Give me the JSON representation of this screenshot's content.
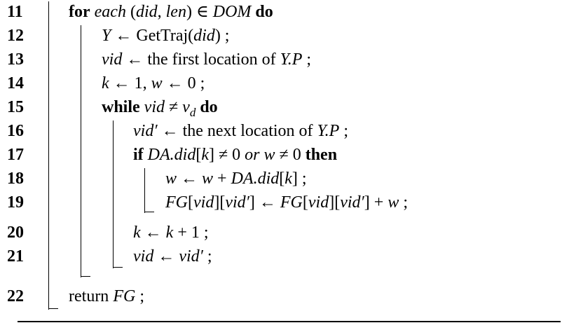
{
  "lines": [
    {
      "num": "11",
      "parts": [
        {
          "t": "for",
          "s": "kw"
        },
        {
          "t": " each",
          "s": "m"
        },
        {
          "t": " (",
          "s": ""
        },
        {
          "t": "did",
          "s": "m"
        },
        {
          "t": ", ",
          "s": ""
        },
        {
          "t": "len",
          "s": "m"
        },
        {
          "t": ") ∈ ",
          "s": ""
        },
        {
          "t": "DOM",
          "s": "m"
        },
        {
          "t": " do",
          "s": "kw"
        }
      ]
    },
    {
      "num": "12",
      "parts": [
        {
          "t": "Y",
          "s": "m"
        },
        {
          "t": " ← GetTraj(",
          "s": ""
        },
        {
          "t": "did",
          "s": "m"
        },
        {
          "t": ") ;",
          "s": ""
        }
      ]
    },
    {
      "num": "13",
      "parts": [
        {
          "t": "vid",
          "s": "m"
        },
        {
          "t": " ← the first location of ",
          "s": ""
        },
        {
          "t": "Y.P",
          "s": "m"
        },
        {
          "t": " ;",
          "s": ""
        }
      ]
    },
    {
      "num": "14",
      "parts": [
        {
          "t": "k",
          "s": "m"
        },
        {
          "t": " ← 1, ",
          "s": ""
        },
        {
          "t": "w",
          "s": "m"
        },
        {
          "t": " ← 0 ;",
          "s": ""
        }
      ]
    },
    {
      "num": "15",
      "parts": [
        {
          "t": "while",
          "s": "kw"
        },
        {
          "t": " vid",
          "s": "m"
        },
        {
          "t": " ≠ ",
          "s": ""
        },
        {
          "t": "v",
          "s": "m"
        },
        {
          "t": "d",
          "s": "sub"
        },
        {
          "t": " do",
          "s": "kw"
        }
      ]
    },
    {
      "num": "16",
      "parts": [
        {
          "t": "vid′",
          "s": "m"
        },
        {
          "t": " ← the next location of ",
          "s": ""
        },
        {
          "t": "Y.P",
          "s": "m"
        },
        {
          "t": " ;",
          "s": ""
        }
      ]
    },
    {
      "num": "17",
      "parts": [
        {
          "t": "if",
          "s": "kw"
        },
        {
          "t": " DA.did",
          "s": "m"
        },
        {
          "t": "[",
          "s": ""
        },
        {
          "t": "k",
          "s": "m"
        },
        {
          "t": "] ≠ 0 ",
          "s": ""
        },
        {
          "t": "or",
          "s": "m"
        },
        {
          "t": " ",
          "s": ""
        },
        {
          "t": "w",
          "s": "m"
        },
        {
          "t": " ≠ 0 ",
          "s": ""
        },
        {
          "t": "then",
          "s": "kw"
        }
      ]
    },
    {
      "num": "18",
      "parts": [
        {
          "t": "w",
          "s": "m"
        },
        {
          "t": " ← ",
          "s": ""
        },
        {
          "t": "w",
          "s": "m"
        },
        {
          "t": " + ",
          "s": ""
        },
        {
          "t": "DA.did",
          "s": "m"
        },
        {
          "t": "[",
          "s": ""
        },
        {
          "t": "k",
          "s": "m"
        },
        {
          "t": "] ;",
          "s": ""
        }
      ]
    },
    {
      "num": "19",
      "parts": [
        {
          "t": "FG",
          "s": "m"
        },
        {
          "t": "[",
          "s": ""
        },
        {
          "t": "vid",
          "s": "m"
        },
        {
          "t": "][",
          "s": ""
        },
        {
          "t": "vid′",
          "s": "m"
        },
        {
          "t": "] ← ",
          "s": ""
        },
        {
          "t": "FG",
          "s": "m"
        },
        {
          "t": "[",
          "s": ""
        },
        {
          "t": "vid",
          "s": "m"
        },
        {
          "t": "][",
          "s": ""
        },
        {
          "t": "vid′",
          "s": "m"
        },
        {
          "t": "] + ",
          "s": ""
        },
        {
          "t": "w",
          "s": "m"
        },
        {
          "t": " ;",
          "s": ""
        }
      ]
    },
    {
      "num": "20",
      "parts": [
        {
          "t": "k",
          "s": "m"
        },
        {
          "t": " ← ",
          "s": ""
        },
        {
          "t": "k",
          "s": "m"
        },
        {
          "t": " + 1 ;",
          "s": ""
        }
      ]
    },
    {
      "num": "21",
      "parts": [
        {
          "t": "vid",
          "s": "m"
        },
        {
          "t": " ← ",
          "s": ""
        },
        {
          "t": "vid′",
          "s": "m"
        },
        {
          "t": " ;",
          "s": ""
        }
      ]
    },
    {
      "num": "22",
      "parts": [
        {
          "t": "return ",
          "s": ""
        },
        {
          "t": "FG",
          "s": "m"
        },
        {
          "t": " ;",
          "s": ""
        }
      ]
    }
  ]
}
